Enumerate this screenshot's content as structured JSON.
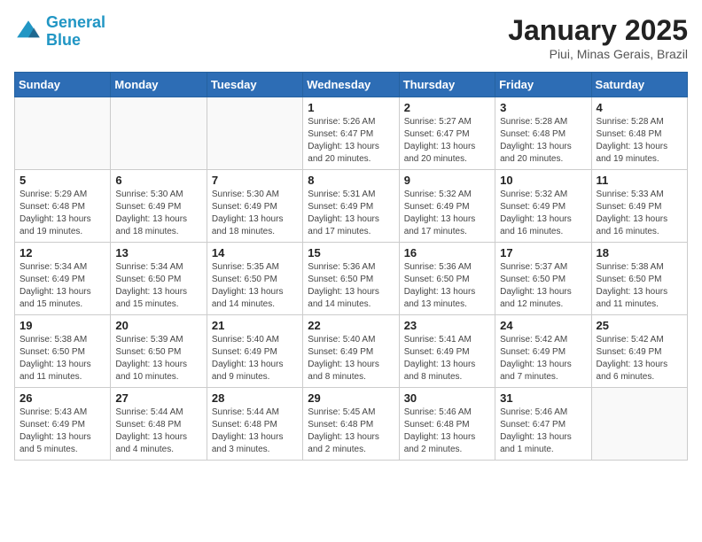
{
  "header": {
    "logo_line1": "General",
    "logo_line2": "Blue",
    "month": "January 2025",
    "location": "Piui, Minas Gerais, Brazil"
  },
  "weekdays": [
    "Sunday",
    "Monday",
    "Tuesday",
    "Wednesday",
    "Thursday",
    "Friday",
    "Saturday"
  ],
  "weeks": [
    [
      {
        "day": "",
        "info": ""
      },
      {
        "day": "",
        "info": ""
      },
      {
        "day": "",
        "info": ""
      },
      {
        "day": "1",
        "info": "Sunrise: 5:26 AM\nSunset: 6:47 PM\nDaylight: 13 hours\nand 20 minutes."
      },
      {
        "day": "2",
        "info": "Sunrise: 5:27 AM\nSunset: 6:47 PM\nDaylight: 13 hours\nand 20 minutes."
      },
      {
        "day": "3",
        "info": "Sunrise: 5:28 AM\nSunset: 6:48 PM\nDaylight: 13 hours\nand 20 minutes."
      },
      {
        "day": "4",
        "info": "Sunrise: 5:28 AM\nSunset: 6:48 PM\nDaylight: 13 hours\nand 19 minutes."
      }
    ],
    [
      {
        "day": "5",
        "info": "Sunrise: 5:29 AM\nSunset: 6:48 PM\nDaylight: 13 hours\nand 19 minutes."
      },
      {
        "day": "6",
        "info": "Sunrise: 5:30 AM\nSunset: 6:49 PM\nDaylight: 13 hours\nand 18 minutes."
      },
      {
        "day": "7",
        "info": "Sunrise: 5:30 AM\nSunset: 6:49 PM\nDaylight: 13 hours\nand 18 minutes."
      },
      {
        "day": "8",
        "info": "Sunrise: 5:31 AM\nSunset: 6:49 PM\nDaylight: 13 hours\nand 17 minutes."
      },
      {
        "day": "9",
        "info": "Sunrise: 5:32 AM\nSunset: 6:49 PM\nDaylight: 13 hours\nand 17 minutes."
      },
      {
        "day": "10",
        "info": "Sunrise: 5:32 AM\nSunset: 6:49 PM\nDaylight: 13 hours\nand 16 minutes."
      },
      {
        "day": "11",
        "info": "Sunrise: 5:33 AM\nSunset: 6:49 PM\nDaylight: 13 hours\nand 16 minutes."
      }
    ],
    [
      {
        "day": "12",
        "info": "Sunrise: 5:34 AM\nSunset: 6:49 PM\nDaylight: 13 hours\nand 15 minutes."
      },
      {
        "day": "13",
        "info": "Sunrise: 5:34 AM\nSunset: 6:50 PM\nDaylight: 13 hours\nand 15 minutes."
      },
      {
        "day": "14",
        "info": "Sunrise: 5:35 AM\nSunset: 6:50 PM\nDaylight: 13 hours\nand 14 minutes."
      },
      {
        "day": "15",
        "info": "Sunrise: 5:36 AM\nSunset: 6:50 PM\nDaylight: 13 hours\nand 14 minutes."
      },
      {
        "day": "16",
        "info": "Sunrise: 5:36 AM\nSunset: 6:50 PM\nDaylight: 13 hours\nand 13 minutes."
      },
      {
        "day": "17",
        "info": "Sunrise: 5:37 AM\nSunset: 6:50 PM\nDaylight: 13 hours\nand 12 minutes."
      },
      {
        "day": "18",
        "info": "Sunrise: 5:38 AM\nSunset: 6:50 PM\nDaylight: 13 hours\nand 11 minutes."
      }
    ],
    [
      {
        "day": "19",
        "info": "Sunrise: 5:38 AM\nSunset: 6:50 PM\nDaylight: 13 hours\nand 11 minutes."
      },
      {
        "day": "20",
        "info": "Sunrise: 5:39 AM\nSunset: 6:50 PM\nDaylight: 13 hours\nand 10 minutes."
      },
      {
        "day": "21",
        "info": "Sunrise: 5:40 AM\nSunset: 6:49 PM\nDaylight: 13 hours\nand 9 minutes."
      },
      {
        "day": "22",
        "info": "Sunrise: 5:40 AM\nSunset: 6:49 PM\nDaylight: 13 hours\nand 8 minutes."
      },
      {
        "day": "23",
        "info": "Sunrise: 5:41 AM\nSunset: 6:49 PM\nDaylight: 13 hours\nand 8 minutes."
      },
      {
        "day": "24",
        "info": "Sunrise: 5:42 AM\nSunset: 6:49 PM\nDaylight: 13 hours\nand 7 minutes."
      },
      {
        "day": "25",
        "info": "Sunrise: 5:42 AM\nSunset: 6:49 PM\nDaylight: 13 hours\nand 6 minutes."
      }
    ],
    [
      {
        "day": "26",
        "info": "Sunrise: 5:43 AM\nSunset: 6:49 PM\nDaylight: 13 hours\nand 5 minutes."
      },
      {
        "day": "27",
        "info": "Sunrise: 5:44 AM\nSunset: 6:48 PM\nDaylight: 13 hours\nand 4 minutes."
      },
      {
        "day": "28",
        "info": "Sunrise: 5:44 AM\nSunset: 6:48 PM\nDaylight: 13 hours\nand 3 minutes."
      },
      {
        "day": "29",
        "info": "Sunrise: 5:45 AM\nSunset: 6:48 PM\nDaylight: 13 hours\nand 2 minutes."
      },
      {
        "day": "30",
        "info": "Sunrise: 5:46 AM\nSunset: 6:48 PM\nDaylight: 13 hours\nand 2 minutes."
      },
      {
        "day": "31",
        "info": "Sunrise: 5:46 AM\nSunset: 6:47 PM\nDaylight: 13 hours\nand 1 minute."
      },
      {
        "day": "",
        "info": ""
      }
    ]
  ]
}
